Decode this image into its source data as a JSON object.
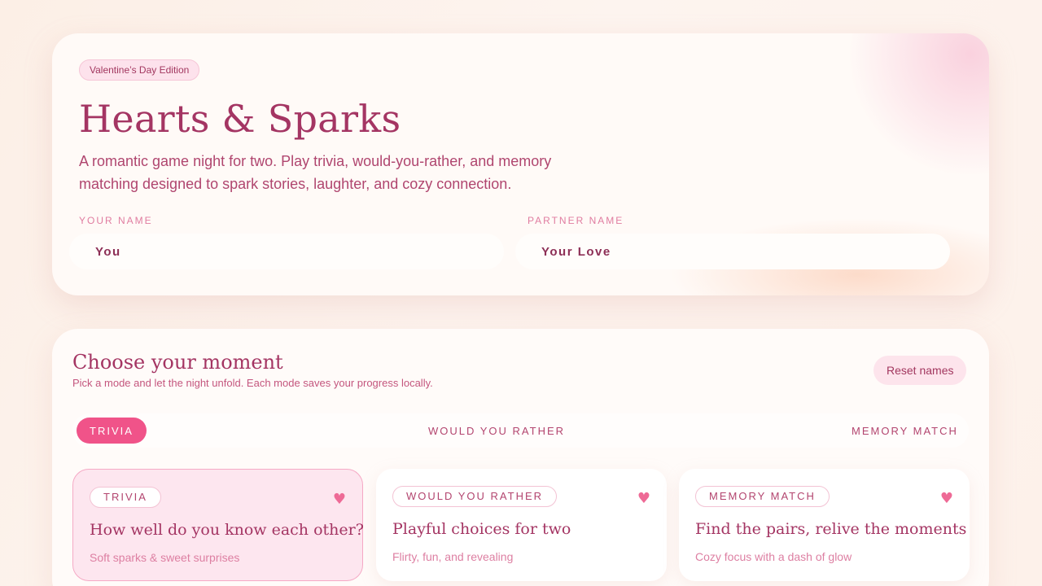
{
  "hero": {
    "badge": "Valentine’s Day Edition",
    "title": "Hearts & Sparks",
    "subtitle": "A romantic game night for two. Play trivia, would-you-rather, and memory matching designed to spark stories, laughter, and cozy connection.",
    "your_name": {
      "label": "YOUR NAME",
      "value": "You"
    },
    "partner_name": {
      "label": "PARTNER NAME",
      "value": "Your Love"
    }
  },
  "panel": {
    "title": "Choose your moment",
    "subtitle": "Pick a mode and let the night unfold. Each mode saves your progress locally.",
    "reset_label": "Reset names",
    "tabs": [
      {
        "label": "TRIVIA",
        "active": true
      },
      {
        "label": "WOULD YOU RATHER",
        "active": false
      },
      {
        "label": "MEMORY MATCH",
        "active": false
      }
    ],
    "cards": [
      {
        "tag": "TRIVIA",
        "title": "How well do you know each other?",
        "desc": "Soft sparks & sweet surprises",
        "heart": "♥",
        "active": true
      },
      {
        "tag": "WOULD YOU RATHER",
        "title": "Playful choices for two",
        "desc": "Flirty, fun, and revealing",
        "heart": "♥",
        "active": false
      },
      {
        "tag": "MEMORY MATCH",
        "title": "Find the pairs, relive the moments",
        "desc": "Cozy focus with a dash of glow",
        "heart": "♥",
        "active": false
      }
    ]
  },
  "colors": {
    "accent": "#f05389",
    "heading": "#a43563",
    "text_soft": "#dd7fa2",
    "page_background": "#fdf2ec"
  }
}
